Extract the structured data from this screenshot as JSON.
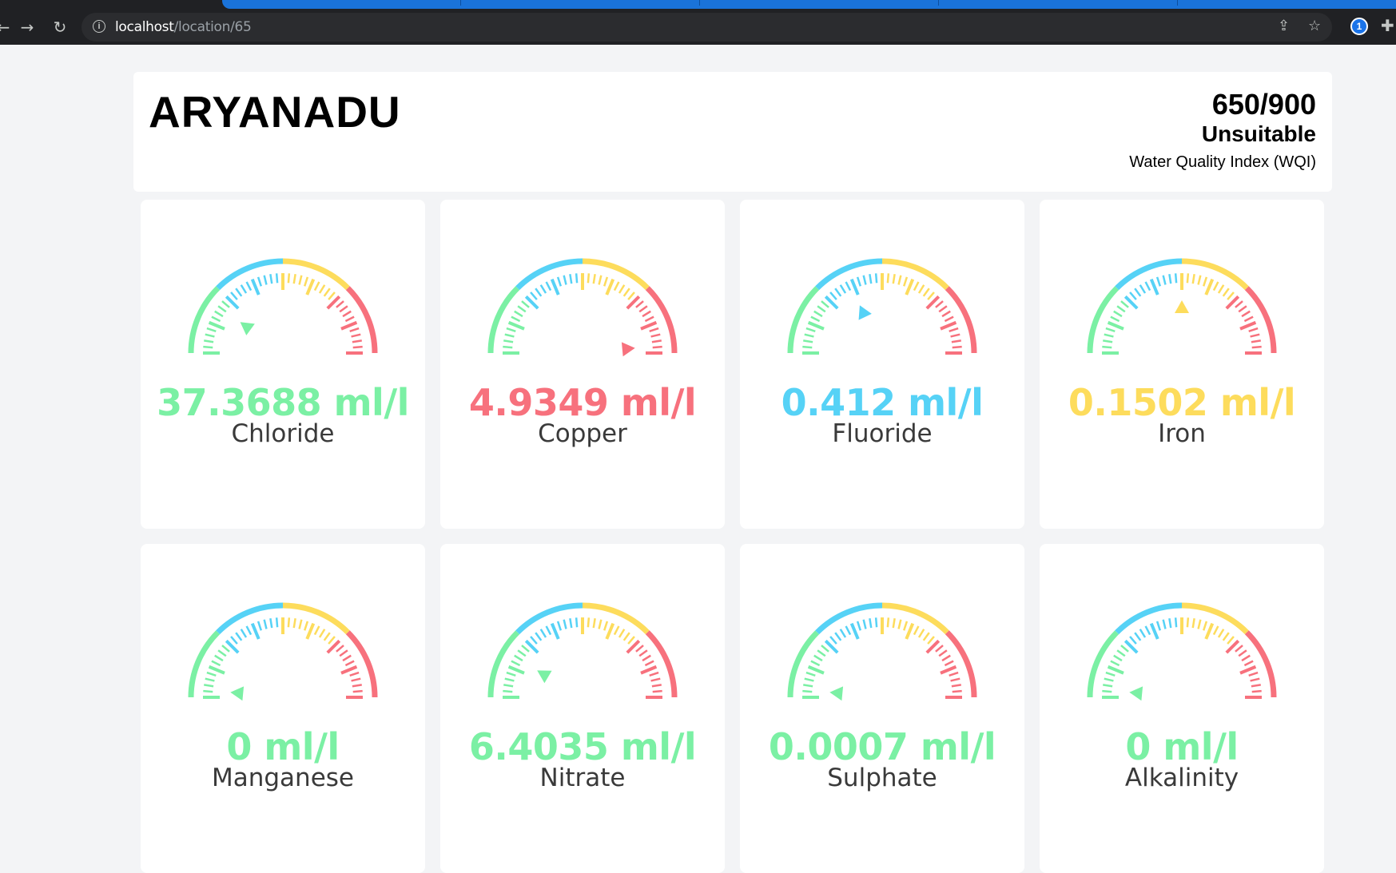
{
  "browser": {
    "url_host": "localhost",
    "url_path": "/location/65"
  },
  "location": {
    "name": "ARYANADU",
    "wqi_score": "650/900",
    "wqi_status": "Unsuitable",
    "wqi_label": "Water Quality Index (WQI)"
  },
  "colors": {
    "green": "#7bf0a4",
    "blue": "#56d2f6",
    "yellow": "#fddc5c",
    "red": "#f7717d"
  },
  "parameters": [
    {
      "name": "Chloride",
      "value": "37.3688 ml/l",
      "level": 0.2,
      "color": "#7bf0a4"
    },
    {
      "name": "Copper",
      "value": "4.9349 ml/l",
      "level": 0.97,
      "color": "#f7717d"
    },
    {
      "name": "Fluoride",
      "value": "0.412 ml/l",
      "level": 0.36,
      "color": "#56d2f6"
    },
    {
      "name": "Iron",
      "value": "0.1502 ml/l",
      "level": 0.5,
      "color": "#fddc5c"
    },
    {
      "name": "Manganese",
      "value": "0 ml/l",
      "level": 0.03,
      "color": "#7bf0a4"
    },
    {
      "name": "Nitrate",
      "value": "6.4035 ml/l",
      "level": 0.17,
      "color": "#7bf0a4"
    },
    {
      "name": "Sulphate",
      "value": "0.0007 ml/l",
      "level": 0.03,
      "color": "#7bf0a4"
    },
    {
      "name": "Alkalinity",
      "value": "0 ml/l",
      "level": 0.03,
      "color": "#7bf0a4"
    }
  ]
}
